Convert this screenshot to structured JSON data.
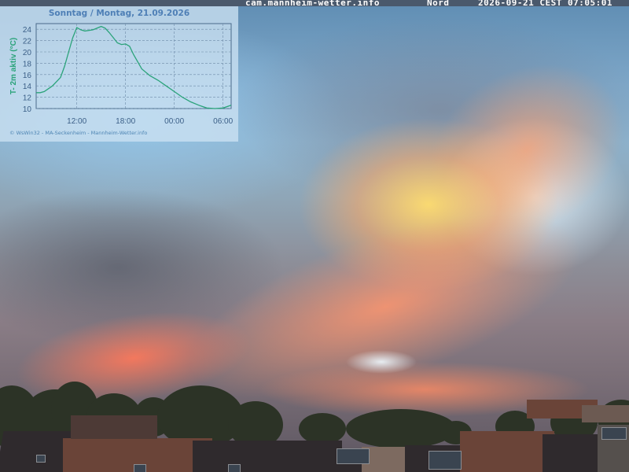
{
  "banner": {
    "site": "cam.mannheim-wetter.info",
    "direction": "Nord",
    "datetime": "2026-09-21 CEST 07:05:01"
  },
  "overlay": {
    "footer": "© WsWin32 - MA-Seckenheim - Mannheim-Wetter.info"
  },
  "colors": {
    "line": "#2ba37a",
    "axis_text": "#3b5f87",
    "grid": "#6d8aa8",
    "ylabel": "#2ba37a"
  },
  "chart_data": {
    "type": "line",
    "title": "Sonntag / Montag, 21.09.2026",
    "ylabel": "T- 2m aktiv (°C)",
    "xlabel": "",
    "x_tick_labels": [
      "12:00",
      "18:00",
      "00:00",
      "06:00"
    ],
    "x_ticks_hours": [
      12,
      18,
      24,
      30
    ],
    "y_ticks": [
      10,
      12,
      14,
      16,
      18,
      20,
      22,
      24
    ],
    "xlim_hours": [
      7,
      31
    ],
    "ylim": [
      10,
      25
    ],
    "grid": true,
    "series": [
      {
        "x_hours": [
          7,
          7.5,
          8,
          9,
          10,
          10.5,
          11,
          11.5,
          12,
          12.5,
          13,
          14,
          15,
          15.5,
          16,
          16.5,
          17,
          17.5,
          18,
          18.5,
          19,
          20,
          21,
          22,
          23,
          24,
          25,
          26,
          27,
          28,
          29,
          30,
          31
        ],
        "y": [
          12.8,
          12.8,
          13.0,
          14.0,
          15.5,
          17.5,
          20.0,
          22.5,
          24.3,
          23.9,
          23.7,
          23.9,
          24.5,
          24.2,
          23.4,
          22.5,
          21.6,
          21.3,
          21.4,
          21.0,
          19.5,
          17.0,
          15.8,
          15.0,
          14.0,
          13.0,
          12.0,
          11.2,
          10.6,
          10.1,
          10.0,
          10.1,
          10.6
        ]
      }
    ]
  }
}
